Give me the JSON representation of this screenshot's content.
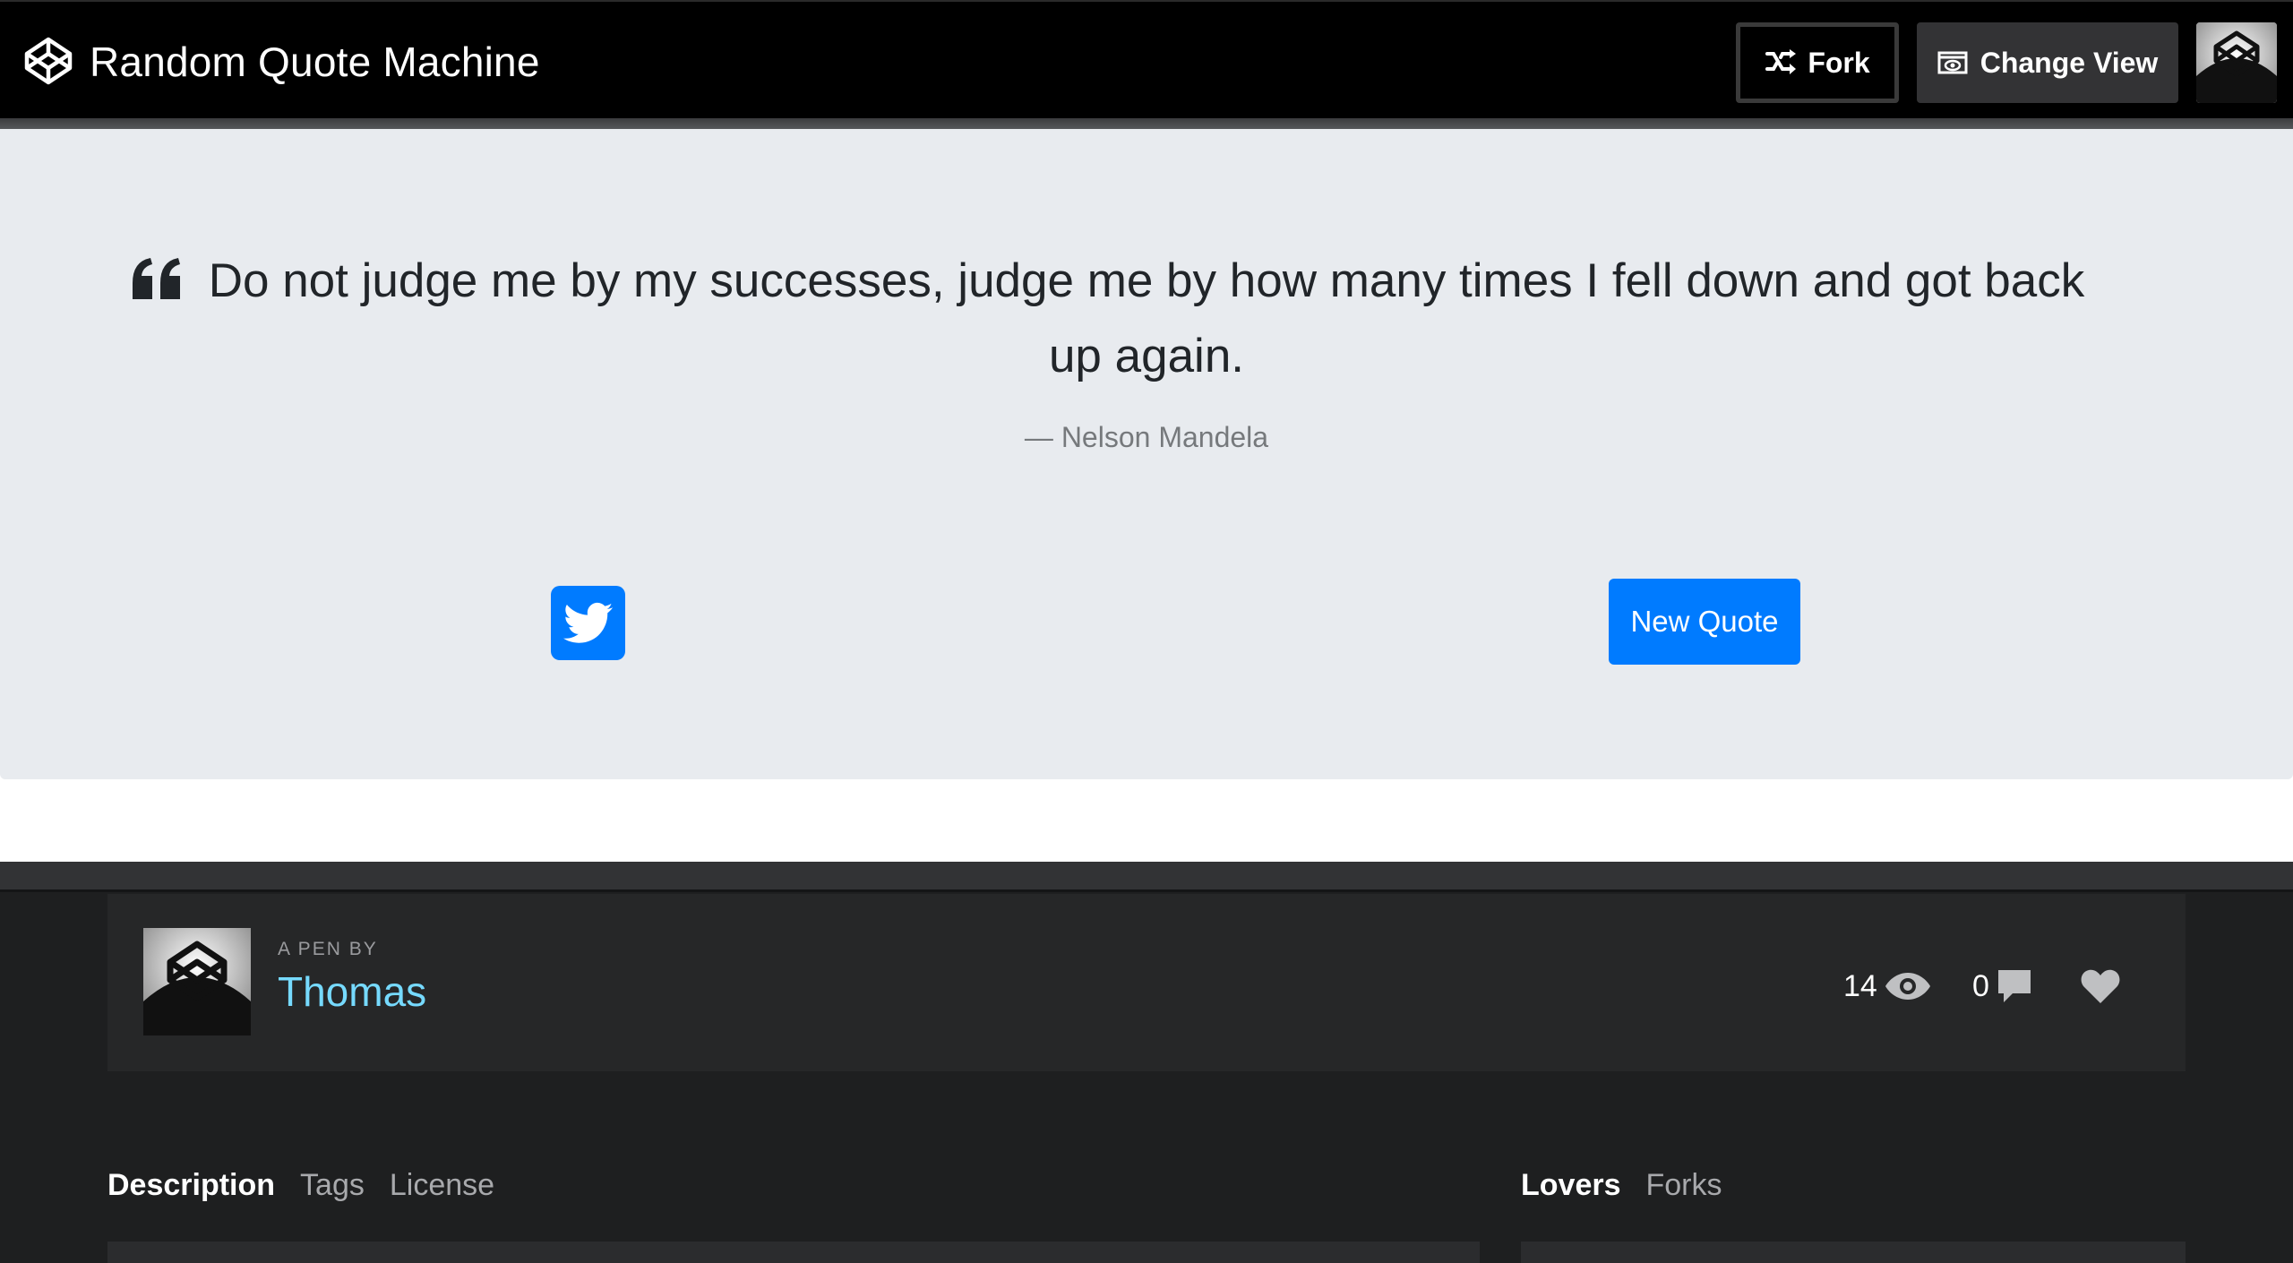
{
  "header": {
    "title": "Random Quote Machine",
    "fork_label": "Fork",
    "change_view_label": "Change View"
  },
  "quote": {
    "text": "Do not judge me by my successes, judge me by how many times I fell down and got back up again.",
    "author": "— Nelson Mandela",
    "new_quote_label": "New Quote"
  },
  "pen": {
    "by_label": "A PEN BY",
    "author_name": "Thomas",
    "views": "14",
    "comments": "0"
  },
  "tabs_left": [
    {
      "label": "Description",
      "active": true
    },
    {
      "label": "Tags",
      "active": false
    },
    {
      "label": "License",
      "active": false
    }
  ],
  "tabs_right": [
    {
      "label": "Lovers",
      "active": true
    },
    {
      "label": "Forks",
      "active": false
    }
  ],
  "colors": {
    "accent_blue": "#007bff",
    "author_link": "#76daff",
    "quote_bg": "#e8ebef"
  },
  "icons": {
    "logo": "codepen-cube-icon",
    "fork": "fork-icon",
    "change_view": "eye-box-icon",
    "quote": "quote-left-icon",
    "tweet": "twitter-bird-icon",
    "views": "eye-icon",
    "comments": "comment-icon",
    "love": "heart-icon"
  }
}
